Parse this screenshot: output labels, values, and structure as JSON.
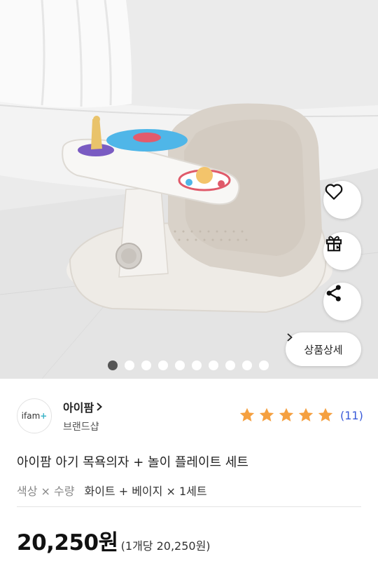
{
  "product_image": {
    "description_icons": [
      "heart-icon",
      "gift-icon",
      "share-icon"
    ],
    "detail_button_label": "상품상세",
    "carousel": {
      "total": 10,
      "active_index": 0
    }
  },
  "brand": {
    "logo_text": "ifam",
    "name": "아이팜",
    "sub_label": "브랜드샵"
  },
  "rating": {
    "stars": 5,
    "review_count": "(11)",
    "star_color": "#f5a040"
  },
  "product": {
    "title": "아이팜 아기 목욕의자 + 놀이 플레이트 세트",
    "option_label": "색상 × 수량",
    "option_value": "화이트 + 베이지 × 1세트"
  },
  "price": {
    "amount": "20,250원",
    "unit_price": "(1개당 20,250원)"
  }
}
